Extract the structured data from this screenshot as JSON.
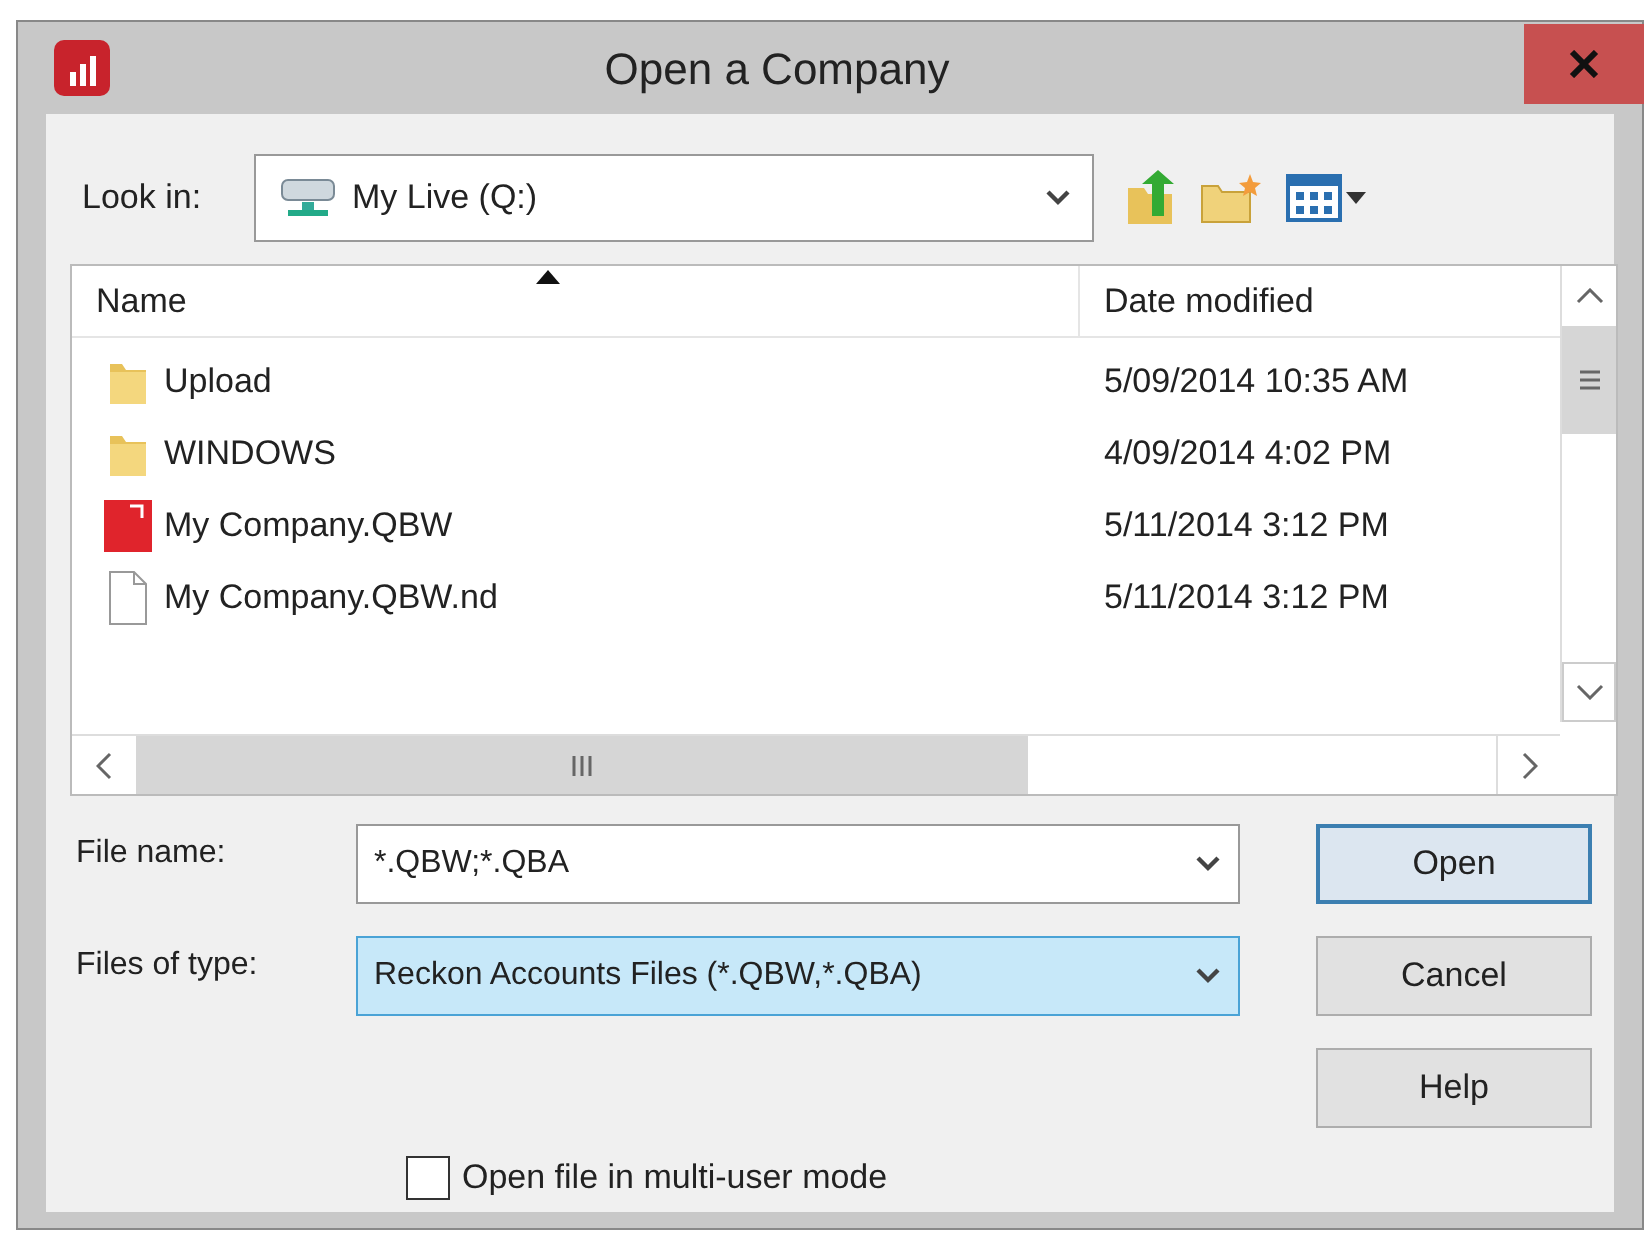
{
  "window": {
    "title": "Open a Company"
  },
  "look_in": {
    "label": "Look in:",
    "value": "My Live (Q:)"
  },
  "file_list": {
    "columns": [
      {
        "label": "Name",
        "sorted": true
      },
      {
        "label": "Date modified",
        "sorted": false
      }
    ],
    "rows": [
      {
        "kind": "folder",
        "name": "Upload",
        "date": "5/09/2014 10:35 AM"
      },
      {
        "kind": "folder",
        "name": "WINDOWS",
        "date": "4/09/2014 4:02 PM"
      },
      {
        "kind": "company",
        "name": "My Company.QBW",
        "date": "5/11/2014 3:12 PM"
      },
      {
        "kind": "file",
        "name": "My Company.QBW.nd",
        "date": "5/11/2014 3:12 PM"
      }
    ]
  },
  "file_name": {
    "label": "File name:",
    "value": "*.QBW;*.QBA"
  },
  "files_of_type": {
    "label": "Files of type:",
    "value": "Reckon Accounts Files (*.QBW,*.QBA)",
    "focused": true
  },
  "buttons": [
    {
      "label": "Open",
      "default": true
    },
    {
      "label": "Cancel",
      "default": false
    },
    {
      "label": "Help",
      "default": false
    }
  ],
  "multi_user": {
    "label": "Open file in multi-user mode",
    "checked": false
  }
}
